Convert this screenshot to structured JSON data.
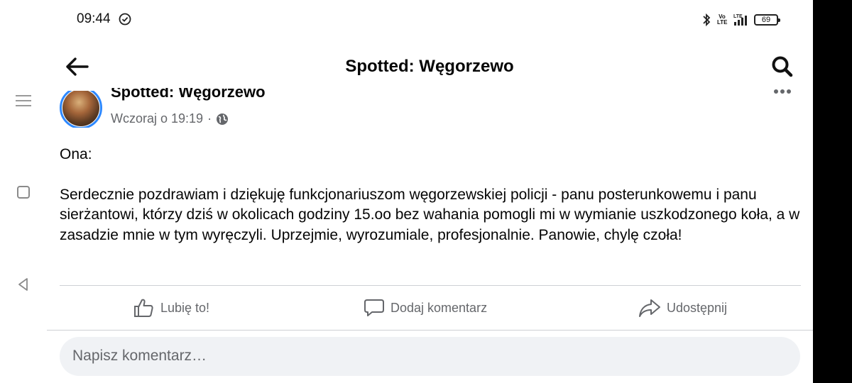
{
  "status_bar": {
    "time": "09:44",
    "battery": "69",
    "network_label": "LTE",
    "volte_label": "Vo LTE"
  },
  "app_bar": {
    "title": "Spotted: Węgorzewo"
  },
  "post": {
    "author": "Spotted: Węgorzewo",
    "timestamp": "Wczoraj o 19:19",
    "separator": "·",
    "audience_icon": "globe-icon",
    "body_lines": [
      "Ona:",
      "Serdecznie pozdrawiam i dziękuję funkcjonariuszom węgorzewskiej policji - panu posterunkowemu i panu sierżantowi, którzy dziś w okolicach godziny 15.oo bez wahania pomogli mi w wymianie uszkodzonego koła, a w zasadzie mnie w tym wyręczyli. Uprzejmie, wyrozumiale, profesjonalnie. Panowie, chylę czoła!"
    ]
  },
  "actions": {
    "like": "Lubię to!",
    "comment": "Dodaj komentarz",
    "share": "Udostępnij"
  },
  "comment_input": {
    "placeholder": "Napisz komentarz…"
  },
  "colors": {
    "text_primary": "#050505",
    "text_secondary": "#65676b",
    "avatar_ring": "#2d88ff",
    "input_bg": "#f0f2f5"
  }
}
